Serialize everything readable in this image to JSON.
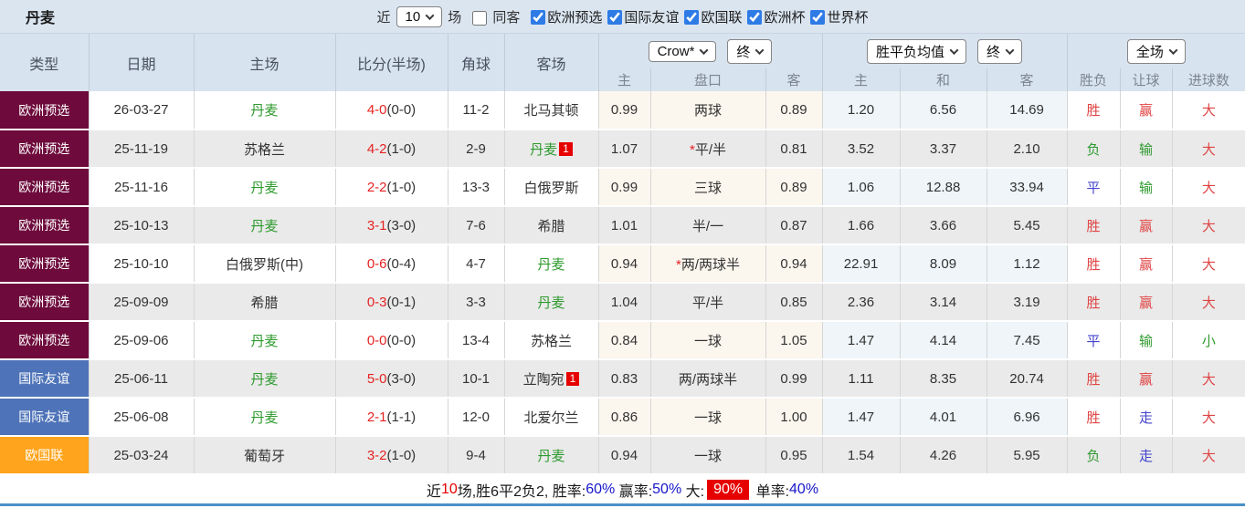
{
  "title": "丹麦",
  "topbar": {
    "recent_label": "近",
    "recent_select": "10",
    "games_label": "场",
    "same_away": {
      "label": "同客",
      "checked": false
    },
    "filters": [
      {
        "label": "欧洲预选",
        "checked": true
      },
      {
        "label": "国际友谊",
        "checked": true
      },
      {
        "label": "欧国联",
        "checked": true
      },
      {
        "label": "欧洲杯",
        "checked": true
      },
      {
        "label": "世界杯",
        "checked": true
      }
    ]
  },
  "header": {
    "col_type": "类型",
    "col_date": "日期",
    "col_home": "主场",
    "col_score": "比分(半场)",
    "col_corners": "角球",
    "col_away": "客场",
    "crow_select": "Crow*",
    "crow_final_select": "终",
    "avg_select": "胜平负均值",
    "avg_final_select": "终",
    "scope_select": "全场",
    "sub_cols": [
      "主",
      "盘口",
      "客",
      "主",
      "和",
      "客",
      "胜负",
      "让球",
      "进球数"
    ]
  },
  "theme": {
    "type_qualifier_bg": "#6E0B3C",
    "type_friendly_bg": "#4E73B8",
    "type_nations_bg": "#FFA41C",
    "team_green": "#2E9A2E",
    "score_red": "#E62222",
    "result_red": "#E04444",
    "result_green": "#2E9A2E",
    "result_blue": "#4444CC",
    "badge_red": "#E60000",
    "header_bg": "#D7E3EF",
    "topbar_bg": "#DAE5F0",
    "crow_cell_bg": "#FBF6EE",
    "avg_cell_bg": "#EFF5F9",
    "even_row_bg": "#EAEAEA",
    "bottom_line_blue": "#4A90C8"
  },
  "rows": [
    {
      "type": "欧洲预选",
      "type_key": "qual",
      "date": "26-03-27",
      "home": "丹麦",
      "home_team": true,
      "home_badge": "",
      "score": "4-0",
      "half": "(0-0)",
      "corners": "11-2",
      "away": "北马其顿",
      "away_team": false,
      "away_badge": "",
      "crow_home": "0.99",
      "star": "",
      "handicap": "两球",
      "crow_away": "0.89",
      "avg_home": "1.20",
      "avg_draw": "6.56",
      "avg_away": "14.69",
      "wdl": "胜",
      "wdl_c": "red",
      "let": "赢",
      "let_c": "red",
      "goal": "大",
      "goal_c": "red"
    },
    {
      "type": "欧洲预选",
      "type_key": "qual",
      "date": "25-11-19",
      "home": "苏格兰",
      "home_team": false,
      "home_badge": "",
      "score": "4-2",
      "half": "(1-0)",
      "corners": "2-9",
      "away": "丹麦",
      "away_team": true,
      "away_badge": "1",
      "crow_home": "1.07",
      "star": "*",
      "handicap": "平/半",
      "crow_away": "0.81",
      "avg_home": "3.52",
      "avg_draw": "3.37",
      "avg_away": "2.10",
      "wdl": "负",
      "wdl_c": "green",
      "let": "输",
      "let_c": "green",
      "goal": "大",
      "goal_c": "red"
    },
    {
      "type": "欧洲预选",
      "type_key": "qual",
      "date": "25-11-16",
      "home": "丹麦",
      "home_team": true,
      "home_badge": "",
      "score": "2-2",
      "half": "(1-0)",
      "corners": "13-3",
      "away": "白俄罗斯",
      "away_team": false,
      "away_badge": "",
      "crow_home": "0.99",
      "star": "",
      "handicap": "三球",
      "crow_away": "0.89",
      "avg_home": "1.06",
      "avg_draw": "12.88",
      "avg_away": "33.94",
      "wdl": "平",
      "wdl_c": "blue",
      "let": "输",
      "let_c": "green",
      "goal": "大",
      "goal_c": "red"
    },
    {
      "type": "欧洲预选",
      "type_key": "qual",
      "date": "25-10-13",
      "home": "丹麦",
      "home_team": true,
      "home_badge": "",
      "score": "3-1",
      "half": "(3-0)",
      "corners": "7-6",
      "away": "希腊",
      "away_team": false,
      "away_badge": "",
      "crow_home": "1.01",
      "star": "",
      "handicap": "半/一",
      "crow_away": "0.87",
      "avg_home": "1.66",
      "avg_draw": "3.66",
      "avg_away": "5.45",
      "wdl": "胜",
      "wdl_c": "red",
      "let": "赢",
      "let_c": "red",
      "goal": "大",
      "goal_c": "red"
    },
    {
      "type": "欧洲预选",
      "type_key": "qual",
      "date": "25-10-10",
      "home": "白俄罗斯(中)",
      "home_team": false,
      "home_badge": "",
      "score": "0-6",
      "half": "(0-4)",
      "corners": "4-7",
      "away": "丹麦",
      "away_team": true,
      "away_badge": "",
      "crow_home": "0.94",
      "star": "*",
      "handicap": "两/两球半",
      "crow_away": "0.94",
      "avg_home": "22.91",
      "avg_draw": "8.09",
      "avg_away": "1.12",
      "wdl": "胜",
      "wdl_c": "red",
      "let": "赢",
      "let_c": "red",
      "goal": "大",
      "goal_c": "red"
    },
    {
      "type": "欧洲预选",
      "type_key": "qual",
      "date": "25-09-09",
      "home": "希腊",
      "home_team": false,
      "home_badge": "",
      "score": "0-3",
      "half": "(0-1)",
      "corners": "3-3",
      "away": "丹麦",
      "away_team": true,
      "away_badge": "",
      "crow_home": "1.04",
      "star": "",
      "handicap": "平/半",
      "crow_away": "0.85",
      "avg_home": "2.36",
      "avg_draw": "3.14",
      "avg_away": "3.19",
      "wdl": "胜",
      "wdl_c": "red",
      "let": "赢",
      "let_c": "red",
      "goal": "大",
      "goal_c": "red"
    },
    {
      "type": "欧洲预选",
      "type_key": "qual",
      "date": "25-09-06",
      "home": "丹麦",
      "home_team": true,
      "home_badge": "",
      "score": "0-0",
      "half": "(0-0)",
      "corners": "13-4",
      "away": "苏格兰",
      "away_team": false,
      "away_badge": "",
      "crow_home": "0.84",
      "star": "",
      "handicap": "一球",
      "crow_away": "1.05",
      "avg_home": "1.47",
      "avg_draw": "4.14",
      "avg_away": "7.45",
      "wdl": "平",
      "wdl_c": "blue",
      "let": "输",
      "let_c": "green",
      "goal": "小",
      "goal_c": "green"
    },
    {
      "type": "国际友谊",
      "type_key": "friendly",
      "date": "25-06-11",
      "home": "丹麦",
      "home_team": true,
      "home_badge": "",
      "score": "5-0",
      "half": "(3-0)",
      "corners": "10-1",
      "away": "立陶宛",
      "away_team": false,
      "away_badge": "1",
      "crow_home": "0.83",
      "star": "",
      "handicap": "两/两球半",
      "crow_away": "0.99",
      "avg_home": "1.11",
      "avg_draw": "8.35",
      "avg_away": "20.74",
      "wdl": "胜",
      "wdl_c": "red",
      "let": "赢",
      "let_c": "red",
      "goal": "大",
      "goal_c": "red"
    },
    {
      "type": "国际友谊",
      "type_key": "friendly",
      "date": "25-06-08",
      "home": "丹麦",
      "home_team": true,
      "home_badge": "",
      "score": "2-1",
      "half": "(1-1)",
      "corners": "12-0",
      "away": "北爱尔兰",
      "away_team": false,
      "away_badge": "",
      "crow_home": "0.86",
      "star": "",
      "handicap": "一球",
      "crow_away": "1.00",
      "avg_home": "1.47",
      "avg_draw": "4.01",
      "avg_away": "6.96",
      "wdl": "胜",
      "wdl_c": "red",
      "let": "走",
      "let_c": "blue",
      "goal": "大",
      "goal_c": "red"
    },
    {
      "type": "欧国联",
      "type_key": "nations",
      "date": "25-03-24",
      "home": "葡萄牙",
      "home_team": false,
      "home_badge": "",
      "score": "3-2",
      "half": "(1-0)",
      "corners": "9-4",
      "away": "丹麦",
      "away_team": true,
      "away_badge": "",
      "crow_home": "0.94",
      "star": "",
      "handicap": "一球",
      "crow_away": "0.95",
      "avg_home": "1.54",
      "avg_draw": "4.26",
      "avg_away": "5.95",
      "wdl": "负",
      "wdl_c": "green",
      "let": "走",
      "let_c": "blue",
      "goal": "大",
      "goal_c": "red"
    }
  ],
  "summary": {
    "seg_recent": "近",
    "games": "10",
    "seg_record": "场,胜6平2负2, 胜率:",
    "win_rate": "60%",
    "seg_ying": " 赢率:",
    "ying_rate": "50%",
    "seg_da": " 大:",
    "da_rate": "90%",
    "seg_dan": " 单率:",
    "dan_rate": "40%"
  }
}
